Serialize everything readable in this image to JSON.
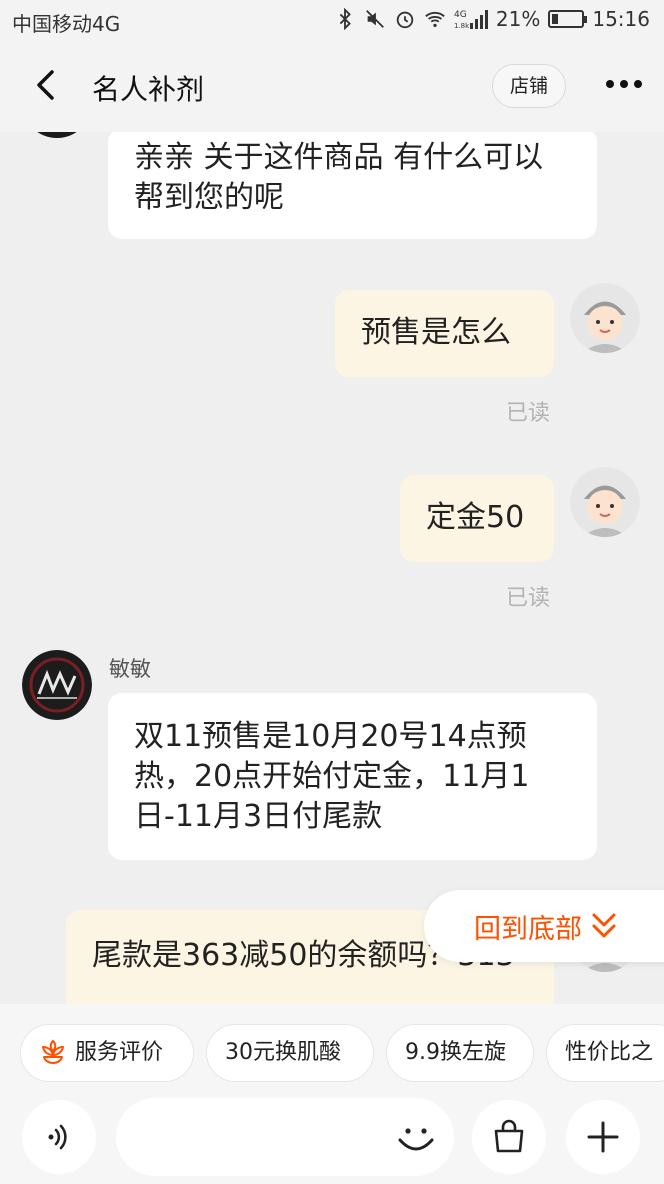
{
  "status_bar": {
    "carrier": "中国移动4G",
    "battery_percent": "21%",
    "battery_level": 0.21,
    "time": "15:16",
    "network_badge_top": "4G",
    "network_badge_bottom": "1.8k"
  },
  "header": {
    "title": "名人补剂",
    "shop_label": "店铺"
  },
  "messages": [
    {
      "direction": "in",
      "text": "亲亲 关于这件商品 有什么可以帮到您的呢"
    },
    {
      "direction": "out",
      "text": "预售是怎么",
      "status": "已读"
    },
    {
      "direction": "out",
      "text": "定金50",
      "status": "已读"
    },
    {
      "direction": "in",
      "sender": "敏敏",
      "text": "双11预售是10月20号14点预热，20点开始付定金，11月1日-11月3日付尾款"
    },
    {
      "direction": "out",
      "text": "尾款是363减50的余额吗？313"
    }
  ],
  "scroll_to_bottom_label": "回到底部",
  "quick_tags": [
    "服务评价",
    "30元换肌酸",
    "9.9换左旋",
    "性价比之"
  ],
  "input": {
    "placeholder": ""
  },
  "icons": {
    "back": "back-arrow-icon",
    "more": "more-dots-icon",
    "voice": "voice-icon",
    "emoji": "smile-icon",
    "bag": "shopping-bag-icon",
    "plus": "plus-icon",
    "service_rating": "flower-icon",
    "scroll_down": "double-chevron-down-icon"
  },
  "colors": {
    "accent": "#ff5000",
    "outgoing_bubble": "#fdf5e4",
    "incoming_bubble": "#ffffff",
    "background": "#efefef"
  }
}
